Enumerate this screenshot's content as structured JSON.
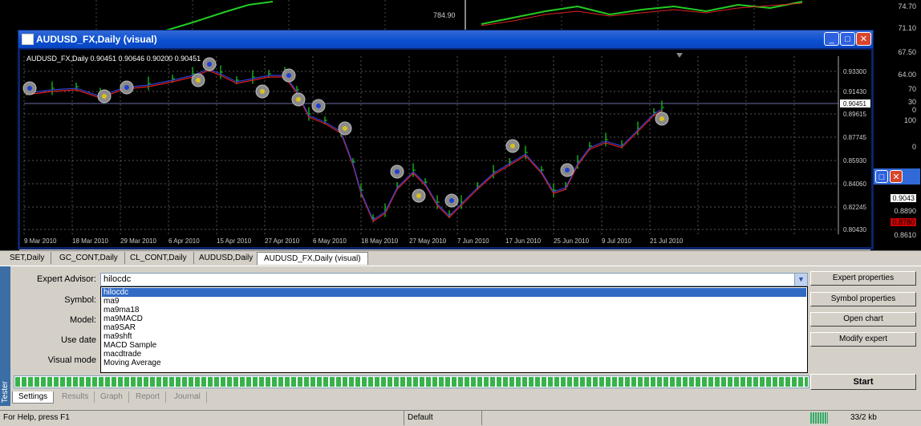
{
  "background": {
    "top_price": "784.90",
    "right_scale": [
      "74.70",
      "71.10",
      "67.50",
      "64.00",
      "70",
      "30",
      "0",
      "100",
      "0",
      "0.9043",
      "0.8890",
      "0.8780",
      "0.8610"
    ]
  },
  "chart_window": {
    "title": "AUDUSD_FX,Daily (visual)",
    "header": "AUDUSD_FX,Daily  0.90451 0.90646 0.90200 0.90451",
    "minimize": "_",
    "restore": "□",
    "close": "✕",
    "price_labels": [
      "0.93300",
      "0.91430",
      "0.90451",
      "0.89615",
      "0.87745",
      "0.85930",
      "0.84060",
      "0.82245",
      "0.80430"
    ],
    "date_labels": [
      "9 Mar 2010",
      "18 Mar 2010",
      "29 Mar 2010",
      "6 Apr 2010",
      "15 Apr 2010",
      "27 Apr 2010",
      "6 May 2010",
      "18 May 2010",
      "27 May 2010",
      "7 Jun 2010",
      "17 Jun 2010",
      "25 Jun 2010",
      "9 Jul 2010",
      "21 Jul 2010"
    ],
    "current_price": "0.90451"
  },
  "chart_tabs": [
    "SET,Daily",
    "GC_CONT,Daily",
    "CL_CONT,Daily",
    "AUDUSD,Daily",
    "AUDUSD_FX,Daily (visual)"
  ],
  "tester": {
    "sidebar_label": "Tester",
    "expert_advisor_label": "Expert Advisor:",
    "expert_advisor_value": "hilocdc",
    "symbol_label": "Symbol:",
    "model_label": "Model:",
    "use_date_label": "Use date",
    "visual_mode_label": "Visual mode",
    "options": [
      "hilocdc",
      "ma9",
      "ma9ma18",
      "ma9MACD",
      "ma9SAR",
      "ma9shft",
      "MACD Sample",
      "macdtrade",
      "Moving Average"
    ],
    "buttons": {
      "expert_properties": "Expert properties",
      "symbol_properties": "Symbol properties",
      "open_chart": "Open chart",
      "modify_expert": "Modify expert",
      "start": "Start"
    },
    "progress": 1.0,
    "bottom_tabs": [
      "Settings",
      "Results",
      "Graph",
      "Report",
      "Journal"
    ]
  },
  "status_bar": {
    "help": "For Help, press F1",
    "profile": "Default",
    "traffic": "33/2 kb"
  }
}
